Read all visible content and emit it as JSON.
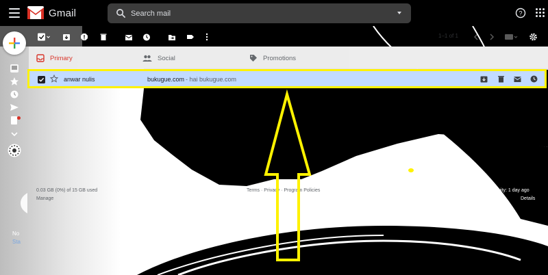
{
  "header": {
    "app_name": "Gmail",
    "search_placeholder": "Search mail"
  },
  "toolbar": {
    "pager": "1–1 of 1"
  },
  "tabs": [
    {
      "label": "Primary",
      "icon": "inbox-icon"
    },
    {
      "label": "Social",
      "icon": "people-icon"
    },
    {
      "label": "Promotions",
      "icon": "tag-icon"
    }
  ],
  "email": {
    "sender": "anwar nulis",
    "subject": "bukugue.com",
    "snippet": " - hai bukugue.com",
    "selected": true,
    "starred": false
  },
  "footer": {
    "storage": "0.03 GB (0%) of 15 GB used",
    "manage": "Manage",
    "terms": "Terms · Privacy · Program Policies",
    "last_activity": "Last account activity: 1 day ago",
    "details": "Details"
  },
  "hangouts": {
    "line1": "No",
    "line2": "Sta"
  },
  "colors": {
    "highlight": "#fff200",
    "selected_row": "#c2dbff",
    "primary_tab": "#d93025",
    "header_bg": "#000000"
  }
}
